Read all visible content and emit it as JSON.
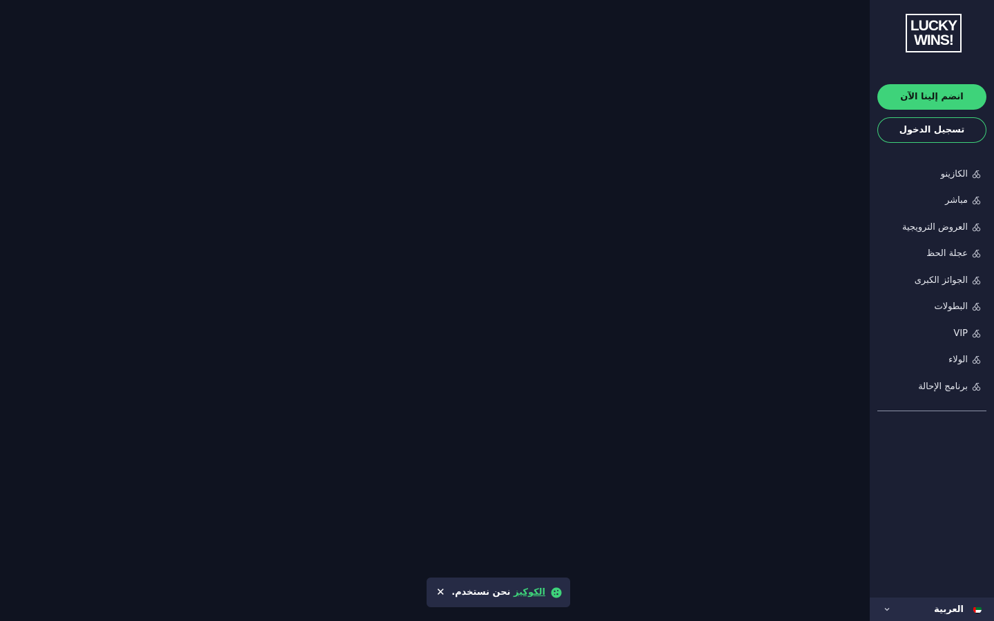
{
  "logo": {
    "line1": "LUCKY",
    "line2": "WINS!"
  },
  "actions": {
    "join_label": "انضم إلينا الآن",
    "login_label": "تسجيل الدخول"
  },
  "nav": {
    "items": [
      {
        "label": "الكازينو",
        "icon": "cherries-icon"
      },
      {
        "label": "مباشر",
        "icon": "cherries-icon"
      },
      {
        "label": "العروض الترويجية",
        "icon": "cherries-icon"
      },
      {
        "label": "عجلة الحظ",
        "icon": "cherries-icon"
      },
      {
        "label": "الجوائز الكبرى",
        "icon": "cherries-icon"
      },
      {
        "label": "البطولات",
        "icon": "cherries-icon"
      },
      {
        "label": "VIP",
        "icon": "cherries-icon"
      },
      {
        "label": "الولاء",
        "icon": "cherries-icon"
      },
      {
        "label": "برنامج الإحالة",
        "icon": "cherries-icon"
      }
    ]
  },
  "language": {
    "selected": "العربية",
    "flag": "uae-flag-icon"
  },
  "cookie_banner": {
    "message": "نحن نستخدم",
    "link_text": "الكوكيز",
    "suffix": "."
  },
  "colors": {
    "accent": "#3ed37a",
    "background": "#0f1320",
    "sidebar": "#1b1f33",
    "panel": "#262b45"
  }
}
